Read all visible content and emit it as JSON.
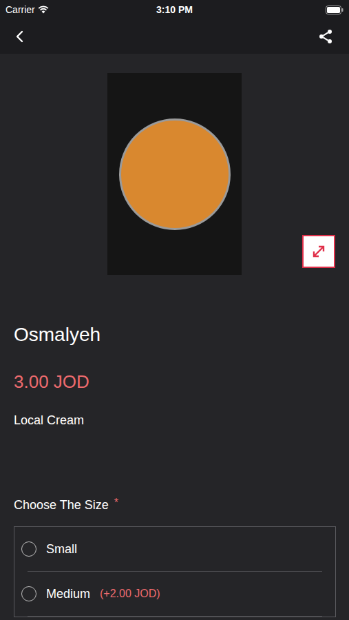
{
  "status_bar": {
    "carrier": "Carrier",
    "time": "3:10 PM"
  },
  "product": {
    "title": "Osmalyeh",
    "price": "3.00 JOD",
    "description": "Local Cream"
  },
  "options": {
    "title": "Choose The Size",
    "required_mark": "*",
    "items": [
      {
        "label": "Small",
        "extra": "",
        "selected": false
      },
      {
        "label": "Medium",
        "extra": "(+2.00 JOD)",
        "selected": false
      }
    ]
  }
}
